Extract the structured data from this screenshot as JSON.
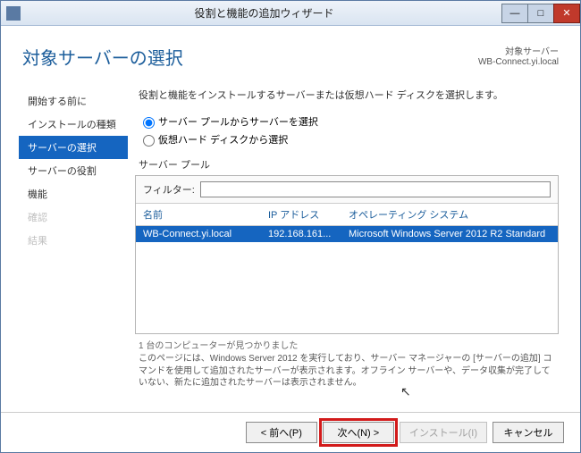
{
  "window": {
    "title": "役割と機能の追加ウィザード"
  },
  "header": {
    "page_title": "対象サーバーの選択",
    "target_label": "対象サーバー",
    "target_name": "WB-Connect.yi.local"
  },
  "sidebar": {
    "items": [
      {
        "label": "開始する前に"
      },
      {
        "label": "インストールの種類"
      },
      {
        "label": "サーバーの選択"
      },
      {
        "label": "サーバーの役割"
      },
      {
        "label": "機能"
      },
      {
        "label": "確認"
      },
      {
        "label": "結果"
      }
    ],
    "selected_index": 2,
    "disabled_from_index": 5
  },
  "main": {
    "instruction": "役割と機能をインストールするサーバーまたは仮想ハード ディスクを選択します。",
    "radio_pool": "サーバー プールからサーバーを選択",
    "radio_vhd": "仮想ハード ディスクから選択",
    "section_label": "サーバー プール",
    "filter_label": "フィルター:",
    "filter_value": "",
    "columns": {
      "name": "名前",
      "ip": "IP アドレス",
      "os": "オペレーティング システム"
    },
    "rows": [
      {
        "name": "WB-Connect.yi.local",
        "ip": "192.168.161...",
        "os": "Microsoft Windows Server 2012 R2 Standard"
      }
    ],
    "count_text": "1 台のコンピューターが見つかりました",
    "help_text": "このページには、Windows Server 2012 を実行しており、サーバー マネージャーの [サーバーの追加] コマンドを使用して追加されたサーバーが表示されます。オフライン サーバーや、データ収集が完了していない、新たに追加されたサーバーは表示されません。"
  },
  "buttons": {
    "prev": "< 前へ(P)",
    "next": "次へ(N) >",
    "install": "インストール(I)",
    "cancel": "キャンセル"
  }
}
